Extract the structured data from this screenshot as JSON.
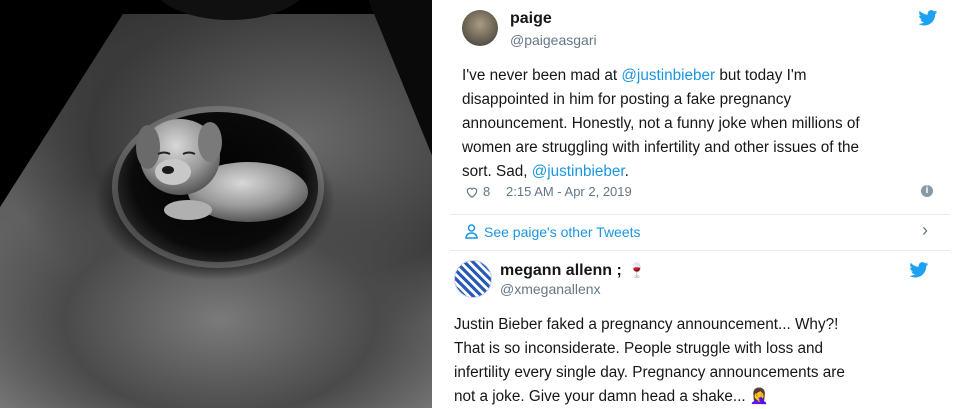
{
  "tweet1": {
    "name": "paige",
    "handle": "@paigeasgari",
    "text_part1": "I've never been mad at ",
    "mention1": "@justinbieber",
    "text_part2": " but today I'm\ndisappointed in him for posting a fake pregnancy\nannouncement. Honestly, not a funny joke when millions of\nwomen are struggling with infertility and other issues of the\nsort. Sad, ",
    "mention2": "@justinbieber",
    "text_part3": ".",
    "likes": "8",
    "timestamp": "2:15 AM - Apr 2, 2019",
    "info_glyph": "i"
  },
  "more_tweets": {
    "label": "See paige's other Tweets"
  },
  "tweet2": {
    "name": "megann allenn ;",
    "name_emoji": "🍷",
    "handle": "@xmeganallenx",
    "text": "Justin Bieber faked a pregnancy announcement... Why?!\nThat is so inconsiderate. People struggle with loss and\ninfertility every single day. Pregnancy announcements are\nnot a joke. Give your damn head a shake... ",
    "text_emoji": "🤦‍♀️"
  },
  "icons": {
    "twitter": "twitter-bird-icon",
    "heart": "heart-icon",
    "info": "info-icon",
    "person": "person-icon",
    "chevron": "chevron-right-icon"
  },
  "colors": {
    "twitter_blue": "#1da1f2",
    "link_blue": "#1b95e0",
    "text": "#14171a",
    "secondary": "#657786"
  }
}
